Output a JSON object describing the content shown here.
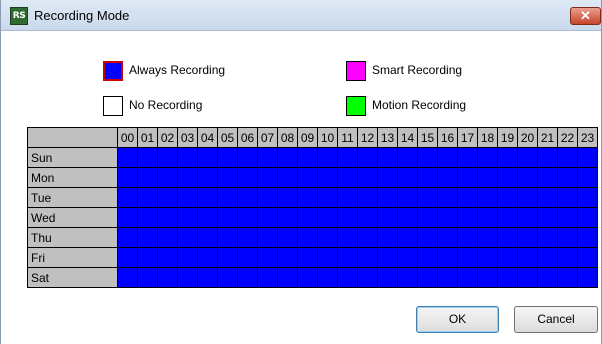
{
  "window": {
    "title": "Recording Mode",
    "app_icon_text": "RS",
    "close_glyph": "✕"
  },
  "legend": [
    {
      "label": "Always Recording",
      "color": "#0000ff",
      "selected": true
    },
    {
      "label": "Smart Recording",
      "color": "#ff00ff",
      "selected": false
    },
    {
      "label": "No Recording",
      "color": "#ffffff",
      "selected": false
    },
    {
      "label": "Motion Recording",
      "color": "#00ff00",
      "selected": false
    }
  ],
  "schedule": {
    "hours": [
      "00",
      "01",
      "02",
      "03",
      "04",
      "05",
      "06",
      "07",
      "08",
      "09",
      "10",
      "11",
      "12",
      "13",
      "14",
      "15",
      "16",
      "17",
      "18",
      "19",
      "20",
      "21",
      "22",
      "23"
    ],
    "days": [
      "Sun",
      "Mon",
      "Tue",
      "Wed",
      "Thu",
      "Fri",
      "Sat"
    ],
    "cell_mode": "Always Recording",
    "cell_color": "#0000ff"
  },
  "buttons": {
    "ok_label": "OK",
    "cancel_label": "Cancel"
  }
}
